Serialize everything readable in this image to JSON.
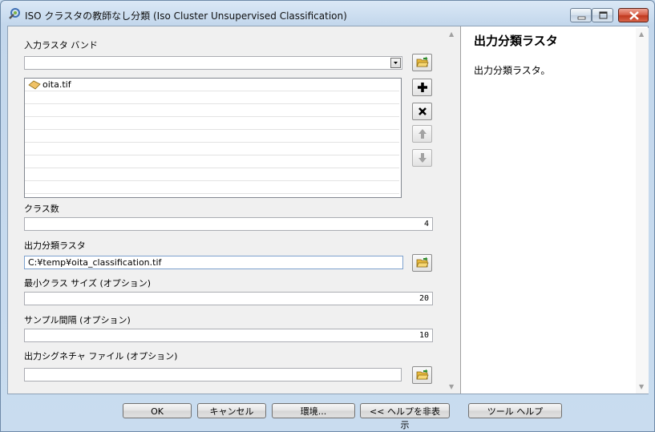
{
  "window": {
    "title": "ISO クラスタの教師なし分類 (Iso Cluster Unsupervised Classification)",
    "icons": {
      "app": "arcgis-tool-icon"
    }
  },
  "form": {
    "input_bands_label": "入力ラスタ バンド",
    "input_bands_combo_value": "",
    "input_bands_list": [
      {
        "icon": "raster-layer-icon",
        "label": "oita.tif"
      }
    ],
    "class_count_label": "クラス数",
    "class_count_value": "4",
    "output_raster_label": "出力分類ラスタ",
    "output_raster_value": "C:¥temp¥oita_classification.tif",
    "min_class_size_label": "最小クラス サイズ (オプション)",
    "min_class_size_value": "20",
    "sample_interval_label": "サンプル間隔 (オプション)",
    "sample_interval_value": "10",
    "output_signature_label": "出力シグネチャ ファイル (オプション)",
    "output_signature_value": ""
  },
  "help_panel": {
    "title": "出力分類ラスタ",
    "description": "出力分類ラスタ。"
  },
  "buttons": {
    "ok": "OK",
    "cancel": "キャンセル",
    "environments": "環境...",
    "hide_help": "<< ヘルプを非表示",
    "tool_help": "ツール ヘルプ"
  },
  "colors": {
    "title_gradient_top": "#dbe8f6",
    "close_button": "#c0391f",
    "dialog_bg": "#f0f0f0",
    "folder_icon": "#e8b93c"
  }
}
